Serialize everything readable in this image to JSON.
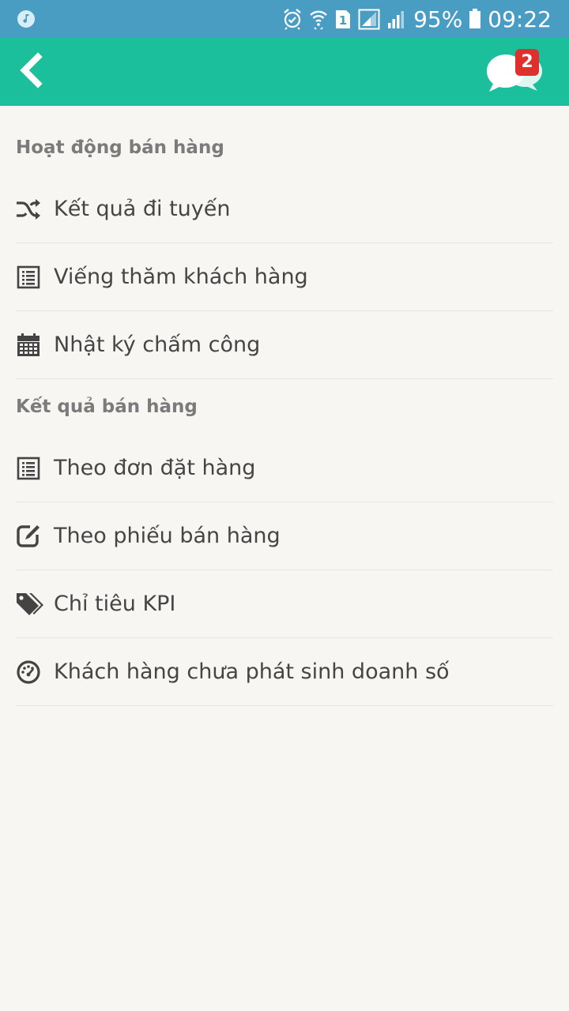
{
  "status_bar": {
    "battery_percent": "95%",
    "time": "09:22",
    "sim_slot": "1",
    "left_icon": "music-note-icon",
    "right_icons": [
      "alarm-icon",
      "wifi-icon",
      "sim-1-icon",
      "signal-1-icon",
      "signal-2-icon",
      "battery-icon"
    ],
    "color": "#4a9dc2"
  },
  "app_bar": {
    "back_icon": "back-chevron-icon",
    "chat_icon": "chat-bubbles-icon",
    "chat_badge_count": "2",
    "color": "#1cbf9b",
    "badge_color": "#e0302d"
  },
  "sections": [
    {
      "title": "Hoạt động bán hàng",
      "items": [
        {
          "label": "Kết quả đi tuyến",
          "icon": "shuffle-icon"
        },
        {
          "label": "Viếng thăm khách hàng",
          "icon": "list-alt-icon"
        },
        {
          "label": "Nhật ký chấm công",
          "icon": "calendar-icon"
        }
      ]
    },
    {
      "title": "Kết quả bán hàng",
      "items": [
        {
          "label": "Theo đơn đặt hàng",
          "icon": "list-alt-icon"
        },
        {
          "label": "Theo phiếu bán hàng",
          "icon": "edit-icon"
        },
        {
          "label": "Chỉ tiêu KPI",
          "icon": "tags-icon"
        },
        {
          "label": "Khách hàng chưa phát sinh doanh số",
          "icon": "dashboard-icon"
        }
      ]
    }
  ]
}
